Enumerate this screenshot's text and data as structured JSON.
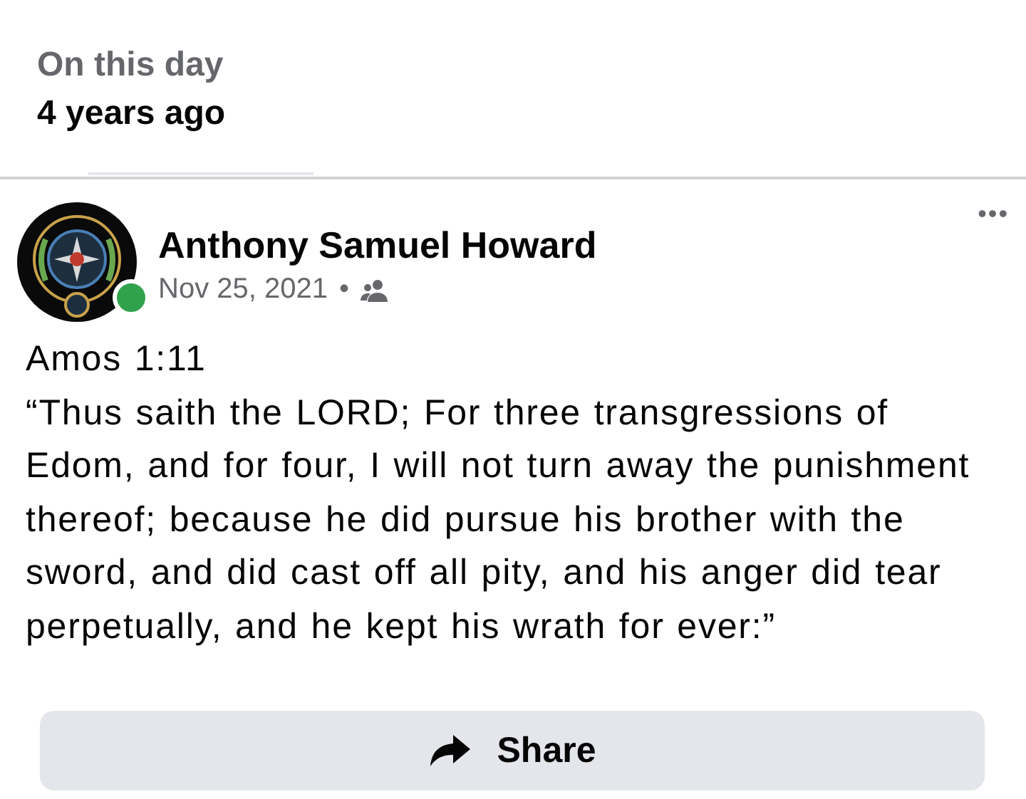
{
  "memory": {
    "title": "On this day",
    "subtitle": "4 years ago"
  },
  "post": {
    "avatar": {
      "kind": "picture",
      "online": true
    },
    "author": "Anthony Samuel Howard",
    "date": "Nov 25, 2021",
    "separator": "•",
    "audience": {
      "kind": "friends"
    },
    "more": "•••",
    "paragraphs": [
      "Amos 1:11",
      "“Thus saith the LORD; For three transgressions of Edom, and for four, I will not turn away the punishment thereof; because he did pursue his brother with the sword, and did cast off all pity, and his anger did tear perpetually, and he kept his wrath for ever:”"
    ]
  },
  "share_button": {
    "label": "Share"
  }
}
